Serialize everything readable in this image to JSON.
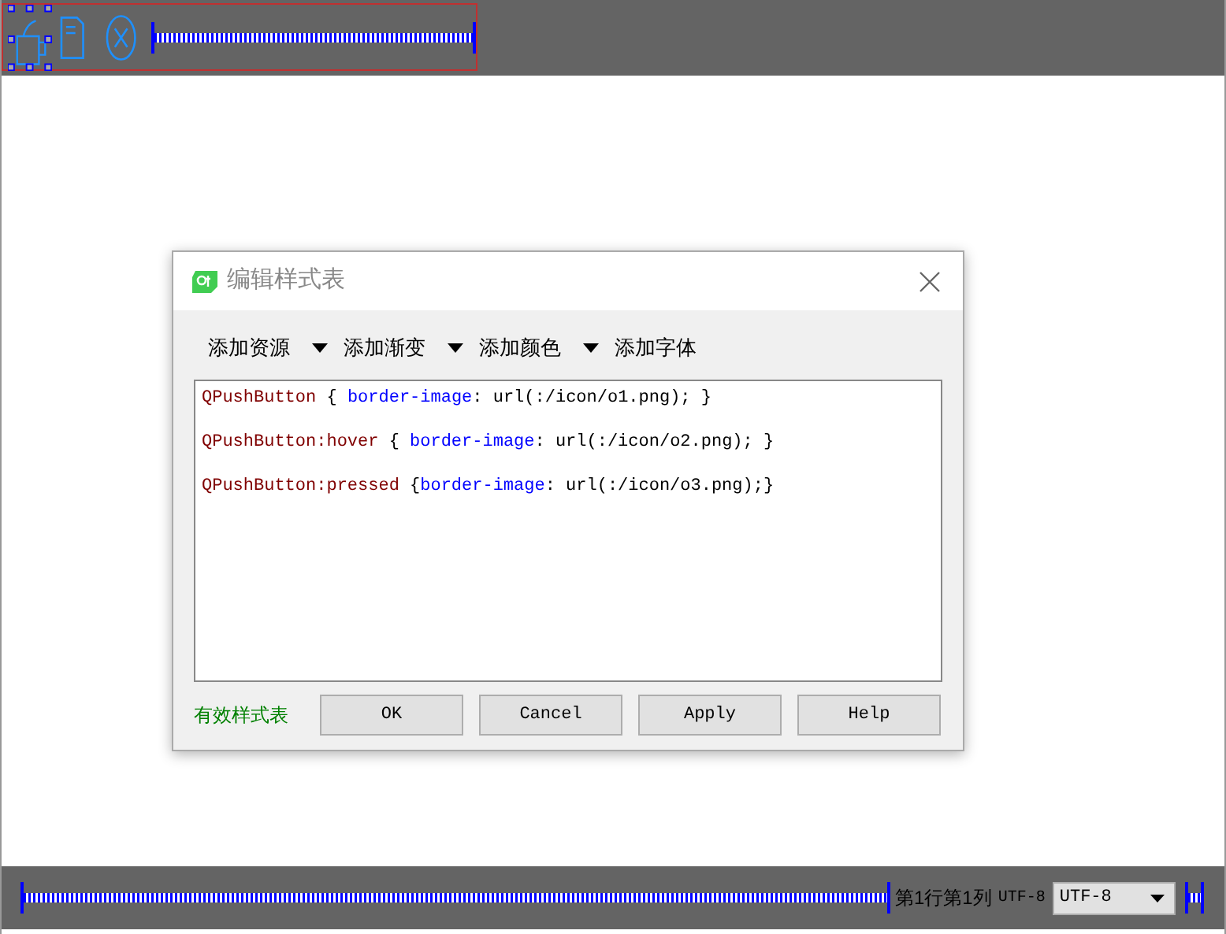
{
  "dialog": {
    "title": "编辑样式表",
    "menu": [
      {
        "label": "添加资源",
        "has_dropdown": true
      },
      {
        "label": "添加渐变",
        "has_dropdown": true
      },
      {
        "label": "添加颜色",
        "has_dropdown": true
      },
      {
        "label": "添加字体",
        "has_dropdown": false
      }
    ],
    "code_lines": [
      [
        {
          "kind": "selector",
          "text": "QPushButton"
        },
        {
          "kind": "plain",
          "text": " { "
        },
        {
          "kind": "property",
          "text": "border-image"
        },
        {
          "kind": "plain",
          "text": ": url(:/icon/o1.png); }"
        }
      ],
      [
        {
          "kind": "selector",
          "text": "QPushButton:hover"
        },
        {
          "kind": "plain",
          "text": " { "
        },
        {
          "kind": "property",
          "text": "border-image"
        },
        {
          "kind": "plain",
          "text": ": url(:/icon/o2.png); }"
        }
      ],
      [
        {
          "kind": "selector",
          "text": "QPushButton:pressed"
        },
        {
          "kind": "plain",
          "text": " {"
        },
        {
          "kind": "property",
          "text": "border-image"
        },
        {
          "kind": "plain",
          "text": ": url(:/icon/o3.png);}"
        }
      ]
    ],
    "status": "有效样式表",
    "buttons": [
      "OK",
      "Cancel",
      "Apply",
      "Help"
    ]
  },
  "status_bar": {
    "position": "第1行第1列",
    "encoding_label": "UTF-8",
    "encoding_select": "UTF-8"
  }
}
